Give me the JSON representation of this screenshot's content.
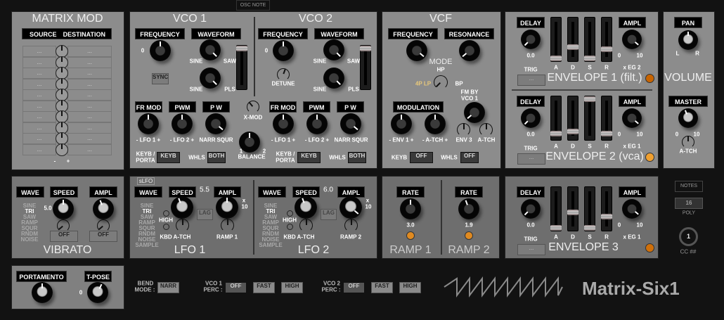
{
  "header": {
    "osc_note": "OSC NOTE"
  },
  "matrix": {
    "title": "MATRIX MOD",
    "source": "SOURCE",
    "destination": "DESTINATION",
    "rows": [
      "...",
      "...",
      "...",
      "...",
      "...",
      "...",
      "...",
      "...",
      "...",
      "..."
    ],
    "minus": "-",
    "plus": "+"
  },
  "vco1": {
    "title": "VCO 1",
    "frequency": "FREQUENCY",
    "waveform": "WAVEFORM",
    "freq_value": "0",
    "sine": "SINE",
    "saw": "SAW",
    "pls": "PLS",
    "sync": "SYNC",
    "fr_mod": "FR  MOD",
    "pwm": "PWM",
    "pw": "P W",
    "lfo1": "-  LFO 1  +",
    "lfo2": "-  LFO 2  +",
    "narr": "NARR",
    "squr": "SQUR",
    "keyb_porta_1": "KEYB /",
    "keyb_porta_2": "PORTA",
    "keyb": "KEYB",
    "whls": "WHLS",
    "both": "BOTH",
    "slider_level": 1.0
  },
  "xmod": {
    "xmod": "X-MOD",
    "balance": "BALANCE",
    "one": "1",
    "two": "2"
  },
  "vco2": {
    "title": "VCO 2",
    "frequency": "FREQUENCY",
    "waveform": "WAVEFORM",
    "freq_value": "0",
    "detune": "DETUNE",
    "sine": "SINE",
    "saw": "SAW",
    "pls": "PLS",
    "fr_mod": "FR  MOD",
    "pwm": "PWM",
    "pw": "P W",
    "lfo1": "-  LFO 1  +",
    "lfo2": "-  LFO 2  +",
    "narr": "NARR",
    "squr": "SQUR",
    "keyb_porta_1": "KEYB /",
    "keyb_porta_2": "PORTA",
    "keyb": "KEYB",
    "whls": "WHLS",
    "both": "BOTH",
    "slider_level": 1.0
  },
  "vcf": {
    "title": "VCF",
    "frequency": "FREQUENCY",
    "resonance": "RESONANCE",
    "mode": "MODE",
    "hp": "HP",
    "lp": "4P LP",
    "bp": "BP",
    "fm1": "FM BY",
    "fm2": "VCO 1",
    "modulation": "MODULATION",
    "env1": "-  ENV 1  +",
    "atch": "-  A-TCH  +",
    "env3": "ENV 3",
    "atch2": "A-TCH",
    "keyb": "KEYB",
    "off1": "OFF",
    "whls": "WHLS",
    "off2": "OFF",
    "lp_color": "#e8c87a"
  },
  "env1": {
    "delay": "DELAY",
    "delay_value": "0.0",
    "ampl": "AMPL",
    "zero": "0",
    "ten": "10",
    "xeg": "x EG 2",
    "trig": "TRIG",
    "trig_btn": "...",
    "title": "ENVELOPE  1  (filt.)",
    "a": "A",
    "d": "D",
    "s": "S",
    "r": "R",
    "levels": [
      0.0,
      0.3,
      0.0,
      0.25
    ],
    "led_color": "#c86400"
  },
  "env2": {
    "delay": "DELAY",
    "delay_value": "0.0",
    "ampl": "AMPL",
    "zero": "0",
    "ten": "10",
    "xeg": "x EG 1",
    "trig": "TRIG",
    "trig_btn": "...",
    "title": "ENVELOPE  2  (vca)",
    "a": "A",
    "d": "D",
    "s": "S",
    "r": "R",
    "levels": [
      0.1,
      0.15,
      1.0,
      0.1
    ],
    "led_color": "#f0a030"
  },
  "env3": {
    "delay": "DELAY",
    "delay_value": "0.0",
    "ampl": "AMPL",
    "zero": "0",
    "ten": "10",
    "xeg": "x EG 1",
    "trig": "TRIG",
    "trig_btn": "...",
    "title": "ENVELOPE  3",
    "a": "A",
    "d": "D",
    "s": "S",
    "r": "R",
    "levels": [
      0.0,
      0.4,
      0.0,
      0.3
    ],
    "led_color": "#d0700a"
  },
  "volume": {
    "pan": "PAN",
    "l": "L",
    "r": "R",
    "title": "VOLUME",
    "master": "MASTER",
    "zero": "0",
    "ten": "10",
    "atch": "A-TCH"
  },
  "vibrato": {
    "wave": "WAVE",
    "speed": "SPEED",
    "ampl": "AMPL",
    "speed_value": "5.0",
    "waves": [
      "SINE",
      "TRI",
      "SAW",
      "RAMP",
      "SQUR",
      "RNDM",
      "NOISE"
    ],
    "selected": "TRI",
    "off1": "OFF",
    "off2": "OFF",
    "title": "VIBRATO"
  },
  "lfo1": {
    "slfo": "sLFO",
    "wave": "WAVE",
    "speed": "SPEED",
    "speed_value": "5.5",
    "ampl": "AMPL",
    "x": "x",
    "ten": "10",
    "waves": [
      "SINE",
      "TRI",
      "SAW",
      "RAMP",
      "SQUR",
      "RNDM",
      "NOISE",
      "SAMPLE"
    ],
    "high": "HIGH",
    "kbd": "KBD",
    "atch": "A-TCH",
    "lag": "LAG",
    "ramp": "RAMP 1",
    "title": "LFO  1"
  },
  "lfo2": {
    "wave": "WAVE",
    "speed": "SPEED",
    "speed_value": "6.0",
    "ampl": "AMPL",
    "x": "x",
    "ten": "10",
    "waves": [
      "SINE",
      "TRI",
      "SAW",
      "RAMP",
      "SQUR",
      "RNDM",
      "NOISE",
      "SAMPLE"
    ],
    "high": "HIGH",
    "kbd": "KBD",
    "atch": "A-TCH",
    "lag": "LAG",
    "ramp": "RAMP 2",
    "title": "LFO  2"
  },
  "ramp1": {
    "rate": "RATE",
    "value": "3.0",
    "title": "RAMP 1"
  },
  "ramp2": {
    "rate": "RATE",
    "value": "1.9",
    "title": "RAMP 2"
  },
  "status": {
    "notes": "NOTES",
    "poly_value": "16",
    "poly": "POLY",
    "cc_value": "1",
    "cc": "CC ##"
  },
  "portamento": {
    "portamento": "PORTAMENTO",
    "tpose": "T-POSE",
    "tpose_value": "0"
  },
  "bottom": {
    "bend1": "BEND",
    "bend2": "MODE :",
    "narr": "NARR",
    "vco1_1": "VCO 1",
    "vco1_2": "PERC :",
    "vco2_1": "VCO 2",
    "vco2_2": "PERC :",
    "off": "OFF",
    "fast": "FAST",
    "high": "HIGH"
  },
  "brand": {
    "name": "Matrix-Six1"
  }
}
